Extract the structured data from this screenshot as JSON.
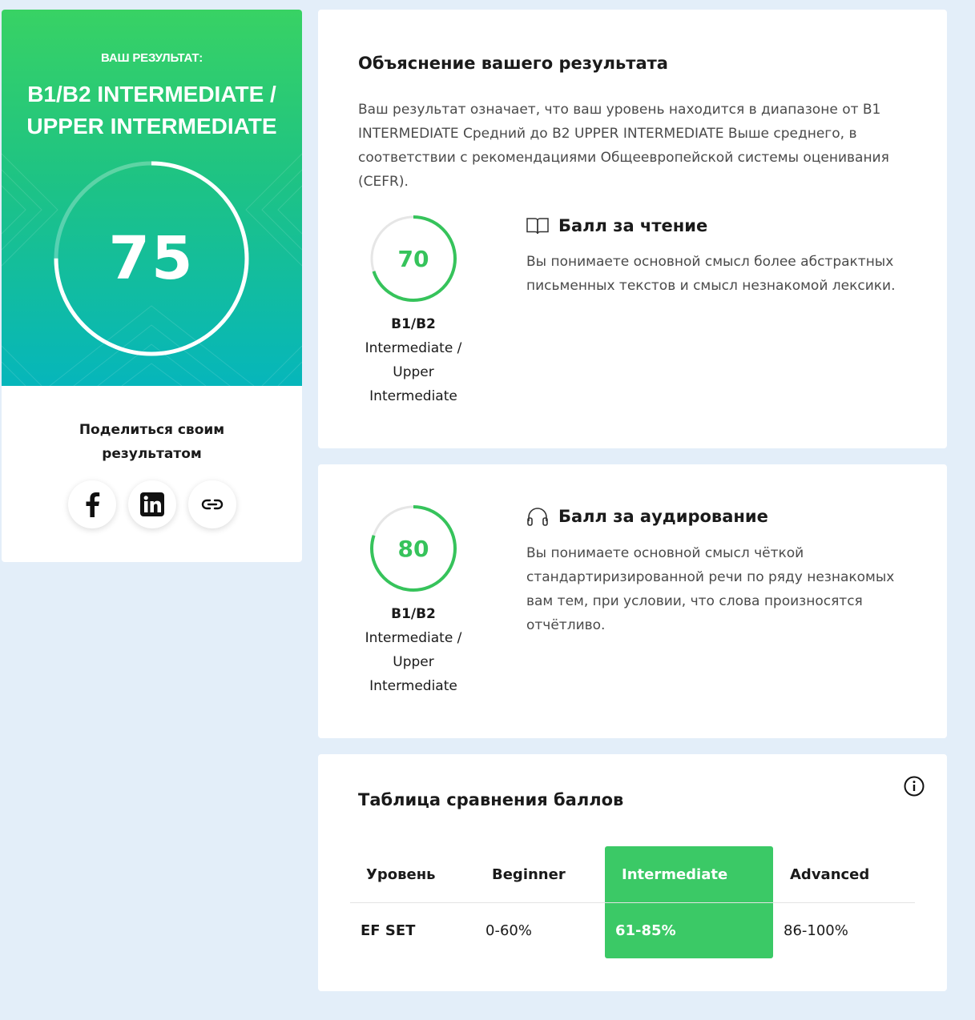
{
  "result_card": {
    "label": "ВАШ РЕЗУЛЬТАТ:",
    "level_line1": "B1/B2 INTERMEDIATE /",
    "level_line2": "UPPER INTERMEDIATE",
    "score": "75",
    "score_fraction": 0.75,
    "share_title": "Поделиться своим результатом",
    "share_buttons": [
      "facebook-icon",
      "linkedin-icon",
      "link-icon"
    ]
  },
  "explanation": {
    "title": "Объяснение вашего результата",
    "text": "Ваш результат означает, что ваш уровень находится в диапазоне от B1 INTERMEDIATE Средний до B2 UPPER INTERMEDIATE Выше среднего, в соответствии с рекомендациями Общеевропейской системы оценивания (CEFR)."
  },
  "reading": {
    "score": "70",
    "score_fraction": 0.7,
    "level_line1": "B1/B2",
    "level_line2": "Intermediate /",
    "level_line3": "Upper",
    "level_line4": "Intermediate",
    "title": "Балл за чтение",
    "icon": "book-icon",
    "description": "Вы понимаете основной смысл более абстрактных письменных текстов и смысл незнакомой лексики."
  },
  "listening": {
    "score": "80",
    "score_fraction": 0.8,
    "level_line1": "B1/B2",
    "level_line2": "Intermediate /",
    "level_line3": "Upper",
    "level_line4": "Intermediate",
    "title": "Балл за аудирование",
    "icon": "headphones-icon",
    "description": "Вы понимаете основной смысл чёткой стандартиризированной речи по ряду незнакомых вам тем, при условии, что слова произносятся отчётливо."
  },
  "comparison": {
    "title": "Таблица сравнения баллов",
    "headers": [
      "Уровень",
      "Beginner",
      "Intermediate",
      "Advanced"
    ],
    "row": [
      "EF SET",
      "0-60%",
      "61-85%",
      "86-100%"
    ],
    "highlighted_column": "Intermediate"
  },
  "colors": {
    "accent_green": "#3bc966",
    "ring_green": "#36c35b",
    "page_bg": "#e3eef9"
  }
}
